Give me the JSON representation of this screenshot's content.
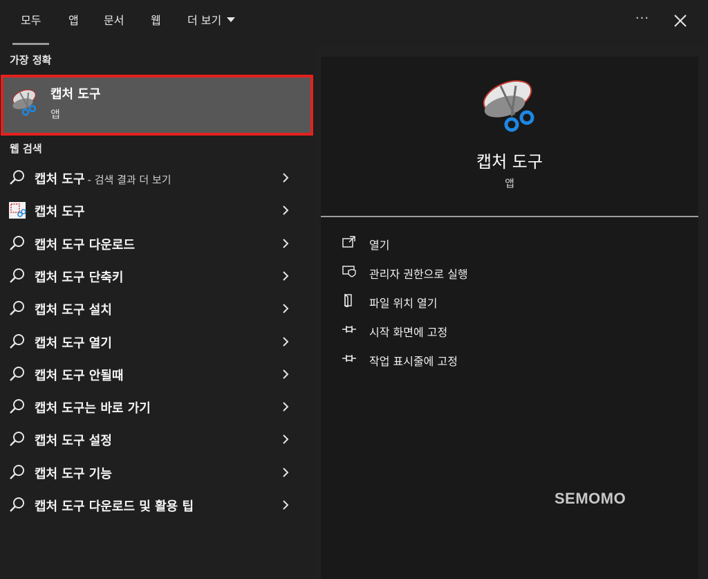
{
  "tabs": [
    {
      "label": "모두",
      "active": true
    },
    {
      "label": "앱"
    },
    {
      "label": "문서"
    },
    {
      "label": "웹"
    },
    {
      "label": "더 보기"
    }
  ],
  "header": {
    "more_label": "···"
  },
  "best_match": {
    "section_label": "가장 정확",
    "title": "캡처 도구",
    "subtitle": "앱",
    "highlight_color": "#e4211e"
  },
  "web_search": {
    "section_label": "웹 검색",
    "items": [
      {
        "label": "캡처 도구",
        "suffix": "- 검색 결과 더 보기",
        "icon": "search-icon"
      },
      {
        "label": "캡처 도구",
        "icon": "snipping-web-icon"
      },
      {
        "label": "캡처 도구 다운로드",
        "icon": "search-icon"
      },
      {
        "label": "캡처 도구 단축키",
        "icon": "search-icon"
      },
      {
        "label": "캡처 도구 설치",
        "icon": "search-icon"
      },
      {
        "label": "캡처 도구 열기",
        "icon": "search-icon"
      },
      {
        "label": "캡처 도구 안될때",
        "icon": "search-icon"
      },
      {
        "label": "캡처 도구는 바로 가기",
        "icon": "search-icon"
      },
      {
        "label": "캡처 도구 설정",
        "icon": "search-icon"
      },
      {
        "label": "캡처 도구 기능",
        "icon": "search-icon"
      },
      {
        "label": "캡처 도구 다운로드 및 활용 팁",
        "icon": "search-icon"
      }
    ]
  },
  "detail": {
    "title": "캡처 도구",
    "type": "앱",
    "actions": [
      {
        "label": "열기",
        "icon": "open-icon"
      },
      {
        "label": "관리자 권한으로 실행",
        "icon": "admin-shield-icon"
      },
      {
        "label": "파일 위치 열기",
        "icon": "file-location-icon"
      },
      {
        "label": "시작 화면에 고정",
        "icon": "pin-icon"
      },
      {
        "label": "작업 표시줄에 고정",
        "icon": "pin-icon"
      }
    ]
  },
  "watermark": "SEMOMO"
}
